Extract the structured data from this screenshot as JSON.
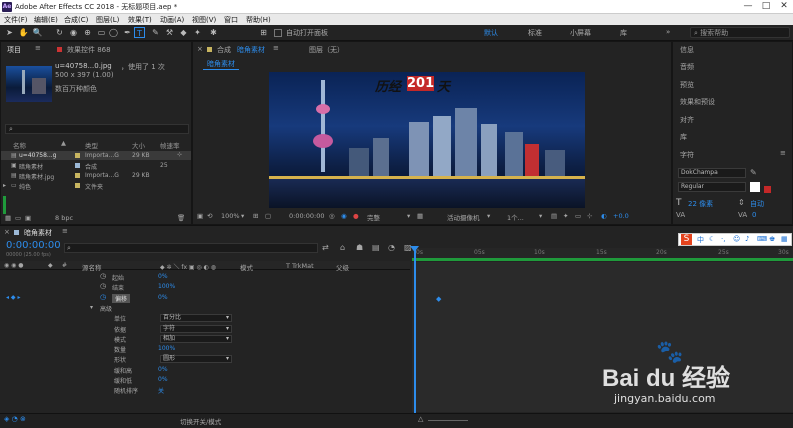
{
  "window": {
    "title": "Adobe After Effects CC 2018 - 无标题项目.aep *",
    "min": "—",
    "max": "□",
    "close": "✕"
  },
  "menu": [
    "文件(F)",
    "编辑(E)",
    "合成(C)",
    "图层(L)",
    "效果(T)",
    "动画(A)",
    "视图(V)",
    "窗口",
    "帮助(H)"
  ],
  "toolbar": {
    "open_panel_label": "自动打开面板",
    "workspaces": [
      "默认",
      "标准",
      "小屏幕",
      "库"
    ],
    "search_placeholder": "搜索帮助"
  },
  "project": {
    "tab_project": "项目",
    "tab_effects": "效果控件 868",
    "preview_name": "u=40758...0.jpg",
    "preview_used": "，使用了 1 次",
    "preview_size": "500 x 397 (1.00)",
    "preview_colors": "数百万种颜色",
    "search_placeholder": "",
    "columns": {
      "name": "名称",
      "type": "类型",
      "size": "大小",
      "rate": "帧速率"
    },
    "items": [
      {
        "name": "u=40758...g",
        "type": "Importa...G",
        "size": "29 KB",
        "rate": "",
        "color": "#c8b560",
        "selected": true
      },
      {
        "name": "暗角素材",
        "type": "合成",
        "size": "",
        "rate": "25",
        "color": "#9bb8d6",
        "selected": false
      },
      {
        "name": "暗角素材.jpg",
        "type": "Importa...G",
        "size": "29 KB",
        "rate": "",
        "color": "#c8b560",
        "selected": false
      },
      {
        "name": "纯色",
        "type": "文件夹",
        "size": "",
        "rate": "",
        "color": "#c8b560",
        "selected": false
      }
    ],
    "bpc": "8 bpc"
  },
  "composition": {
    "tab_prefix": "合成",
    "tab_name": "暗角素材",
    "layer_tab": "图层（无）",
    "breadcrumb": "暗角素材",
    "overlay_text_a": "历经",
    "overlay_text_b": "201",
    "overlay_text_c": "天",
    "zoom": "100%",
    "timecode": "0:00:00:00",
    "quality": "完整",
    "camera": "活动摄像机",
    "views": "1个...",
    "offset": "+0.0"
  },
  "right_panel": {
    "items": [
      "信息",
      "音频",
      "预览",
      "效果和预设",
      "对齐",
      "库",
      "字符"
    ],
    "font": "DokChampa",
    "style": "Regular",
    "size": "22 像素",
    "leading": "自动",
    "tracking": "0"
  },
  "timeline": {
    "tab": "暗角素材",
    "timecode": "0:00:00:00",
    "fps": "00000 (25.00 fps)",
    "search_placeholder": "",
    "columns": {
      "source": "源名称",
      "mode": "模式",
      "trkmat": "T TrkMat",
      "parent": "父级"
    },
    "ruler_ticks": [
      "0s",
      "05s",
      "10s",
      "15s",
      "20s",
      "25s",
      "30s"
    ],
    "props": [
      {
        "label": "起始",
        "value": "0%",
        "indent": 2
      },
      {
        "label": "结束",
        "value": "100%",
        "indent": 2
      },
      {
        "label": "偏移",
        "value": "0%",
        "indent": 2,
        "keyed": true
      },
      {
        "label": "高级",
        "value": "",
        "indent": 1,
        "group": true
      },
      {
        "label": "单位",
        "value": "百分比",
        "indent": 3,
        "select": true
      },
      {
        "label": "依据",
        "value": "字符",
        "indent": 3,
        "select": true
      },
      {
        "label": "模式",
        "value": "相加",
        "indent": 3,
        "select": true
      },
      {
        "label": "数量",
        "value": "100%",
        "indent": 3
      },
      {
        "label": "形状",
        "value": "圆形",
        "indent": 3,
        "select": true
      },
      {
        "label": "缓和高",
        "value": "0%",
        "indent": 3
      },
      {
        "label": "缓和低",
        "value": "0%",
        "indent": 3
      },
      {
        "label": "随机排序",
        "value": "关",
        "indent": 3
      }
    ],
    "switch_label": "切换开关/模式"
  },
  "watermark": {
    "brand": "Bai du 经验",
    "url": "jingyan.baidu.com"
  },
  "colors": {
    "accent": "#2d8ceb",
    "bg": "#232323",
    "green_bar": "#1f9a3b"
  }
}
